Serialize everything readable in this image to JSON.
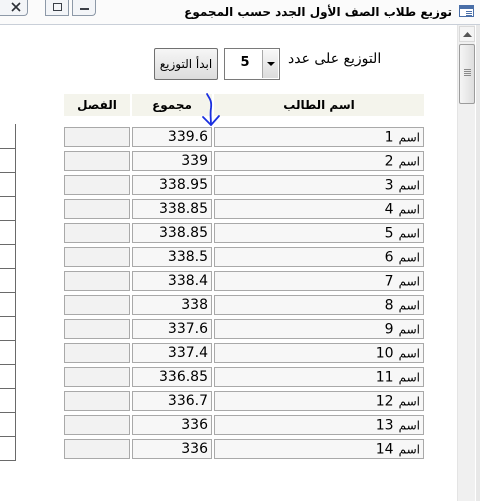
{
  "window": {
    "title": "توزيع طلاب الصف الأول الجدد حسب المجموع"
  },
  "controls": {
    "distribute_label": "التوزيع على عدد",
    "count_value": "5",
    "start_button": "ابدأ التوزيع"
  },
  "table": {
    "headers": {
      "name": "اسم الطالب",
      "total": "مجموع",
      "class": "الفصل"
    },
    "rows": [
      {
        "label": "اسم",
        "num": "1",
        "total": "339.6",
        "class": ""
      },
      {
        "label": "اسم",
        "num": "2",
        "total": "339",
        "class": ""
      },
      {
        "label": "اسم",
        "num": "3",
        "total": "338.95",
        "class": ""
      },
      {
        "label": "اسم",
        "num": "4",
        "total": "338.85",
        "class": ""
      },
      {
        "label": "اسم",
        "num": "5",
        "total": "338.85",
        "class": ""
      },
      {
        "label": "اسم",
        "num": "6",
        "total": "338.5",
        "class": ""
      },
      {
        "label": "اسم",
        "num": "7",
        "total": "338.4",
        "class": ""
      },
      {
        "label": "اسم",
        "num": "8",
        "total": "338",
        "class": ""
      },
      {
        "label": "اسم",
        "num": "9",
        "total": "337.6",
        "class": ""
      },
      {
        "label": "اسم",
        "num": "10",
        "total": "337.4",
        "class": ""
      },
      {
        "label": "اسم",
        "num": "11",
        "total": "336.85",
        "class": ""
      },
      {
        "label": "اسم",
        "num": "12",
        "total": "336.7",
        "class": ""
      },
      {
        "label": "اسم",
        "num": "13",
        "total": "336",
        "class": ""
      },
      {
        "label": "اسم",
        "num": "14",
        "total": "336",
        "class": ""
      }
    ]
  },
  "colors": {
    "header_bg": "#f4f4ec",
    "annotation_arrow": "#1a2fe0",
    "window_icon": "#4a6fa8"
  },
  "icons": [
    "close-icon",
    "restore-icon",
    "minimize-icon",
    "form-icon",
    "scroll-up-icon",
    "dropdown-arrow-icon",
    "annotation-arrow-icon"
  ]
}
